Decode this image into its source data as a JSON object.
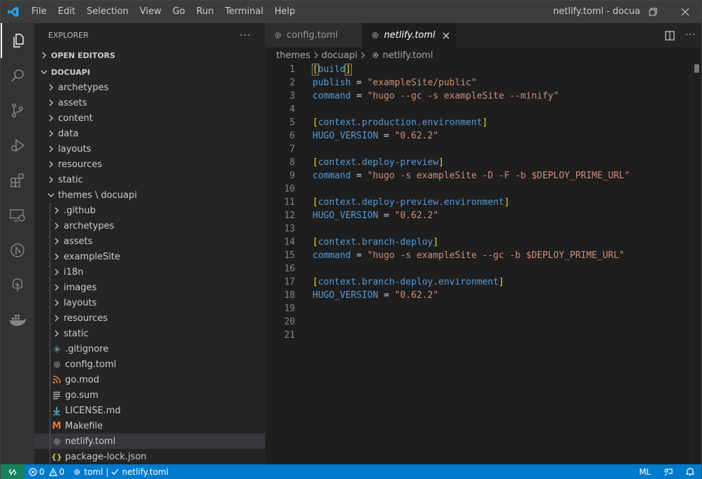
{
  "menu": [
    "File",
    "Edit",
    "Selection",
    "View",
    "Go",
    "Run",
    "Terminal",
    "Help"
  ],
  "window_title": "netlify.toml - docuapi - Visual Studio Code",
  "activity_icons": [
    "files-icon",
    "search-icon",
    "source-control-icon",
    "run-debug-icon",
    "extensions-icon",
    "remote-explorer-icon",
    "git-graph-icon",
    "tree-icon",
    "docker-icon"
  ],
  "sidebar": {
    "title": "EXPLORER",
    "more": "···",
    "open_editors": "OPEN EDITORS",
    "root": "DOCUAPI",
    "items": [
      {
        "label": "archetypes",
        "type": "folder",
        "depth": 1
      },
      {
        "label": "assets",
        "type": "folder",
        "depth": 1
      },
      {
        "label": "content",
        "type": "folder",
        "depth": 1
      },
      {
        "label": "data",
        "type": "folder",
        "depth": 1
      },
      {
        "label": "layouts",
        "type": "folder",
        "depth": 1
      },
      {
        "label": "resources",
        "type": "folder",
        "depth": 1
      },
      {
        "label": "static",
        "type": "folder",
        "depth": 1
      },
      {
        "label": "themes \\ docuapi",
        "type": "folder-open",
        "depth": 1
      },
      {
        "label": ".github",
        "type": "folder",
        "depth": 2
      },
      {
        "label": "archetypes",
        "type": "folder",
        "depth": 2
      },
      {
        "label": "assets",
        "type": "folder",
        "depth": 2
      },
      {
        "label": "exampleSite",
        "type": "folder",
        "depth": 2
      },
      {
        "label": "i18n",
        "type": "folder",
        "depth": 2
      },
      {
        "label": "images",
        "type": "folder",
        "depth": 2
      },
      {
        "label": "layouts",
        "type": "folder",
        "depth": 2
      },
      {
        "label": "resources",
        "type": "folder",
        "depth": 2
      },
      {
        "label": "static",
        "type": "folder",
        "depth": 2
      },
      {
        "label": ".gitignore",
        "type": "gitignore",
        "depth": 2
      },
      {
        "label": "config.toml",
        "type": "gear",
        "depth": 2
      },
      {
        "label": "go.mod",
        "type": "gomod",
        "depth": 2
      },
      {
        "label": "go.sum",
        "type": "gosum",
        "depth": 2
      },
      {
        "label": "LICENSE.md",
        "type": "license",
        "depth": 2
      },
      {
        "label": "Makefile",
        "type": "makefile",
        "depth": 2
      },
      {
        "label": "netlify.toml",
        "type": "gear",
        "depth": 2,
        "selected": true
      },
      {
        "label": "package-lock.json",
        "type": "json",
        "depth": 2
      }
    ]
  },
  "tabs": [
    {
      "label": "config.toml",
      "active": false
    },
    {
      "label": "netlify.toml",
      "active": true
    }
  ],
  "breadcrumb": [
    "themes",
    "docuapi",
    "netlify.toml"
  ],
  "code_lines": [
    [
      {
        "t": "[",
        "c": "#ffd700"
      },
      {
        "t": "build",
        "c": "#569cd6"
      },
      {
        "t": "]",
        "c": "#ffd700"
      }
    ],
    [
      {
        "t": "publish",
        "c": "#569cd6"
      },
      {
        "t": " = ",
        "c": "#d4d4d4"
      },
      {
        "t": "\"exampleSite/public\"",
        "c": "#ce9178"
      }
    ],
    [
      {
        "t": "command",
        "c": "#569cd6"
      },
      {
        "t": " = ",
        "c": "#d4d4d4"
      },
      {
        "t": "\"hugo --gc -s exampleSite --minify\"",
        "c": "#ce9178"
      }
    ],
    [],
    [
      {
        "t": "[",
        "c": "#ffd700"
      },
      {
        "t": "context.production.environment",
        "c": "#569cd6"
      },
      {
        "t": "]",
        "c": "#ffd700"
      }
    ],
    [
      {
        "t": "HUGO_VERSION",
        "c": "#569cd6"
      },
      {
        "t": " = ",
        "c": "#d4d4d4"
      },
      {
        "t": "\"0.62.2\"",
        "c": "#ce9178"
      }
    ],
    [],
    [
      {
        "t": "[",
        "c": "#ffd700"
      },
      {
        "t": "context.deploy-preview",
        "c": "#569cd6"
      },
      {
        "t": "]",
        "c": "#ffd700"
      }
    ],
    [
      {
        "t": "command",
        "c": "#569cd6"
      },
      {
        "t": " = ",
        "c": "#d4d4d4"
      },
      {
        "t": "\"hugo -s exampleSite -D -F -b $DEPLOY_PRIME_URL\"",
        "c": "#ce9178"
      }
    ],
    [],
    [
      {
        "t": "[",
        "c": "#ffd700"
      },
      {
        "t": "context.deploy-preview.environment",
        "c": "#569cd6"
      },
      {
        "t": "]",
        "c": "#ffd700"
      }
    ],
    [
      {
        "t": "HUGO_VERSION",
        "c": "#569cd6"
      },
      {
        "t": " = ",
        "c": "#d4d4d4"
      },
      {
        "t": "\"0.62.2\"",
        "c": "#ce9178"
      }
    ],
    [],
    [
      {
        "t": "[",
        "c": "#ffd700"
      },
      {
        "t": "context.branch-deploy",
        "c": "#569cd6"
      },
      {
        "t": "]",
        "c": "#ffd700"
      }
    ],
    [
      {
        "t": "command",
        "c": "#569cd6"
      },
      {
        "t": " = ",
        "c": "#d4d4d4"
      },
      {
        "t": "\"hugo -s exampleSite --gc -b $DEPLOY_PRIME_URL\"",
        "c": "#ce9178"
      }
    ],
    [],
    [
      {
        "t": "[",
        "c": "#ffd700"
      },
      {
        "t": "context.branch-deploy.environment",
        "c": "#569cd6"
      },
      {
        "t": "]",
        "c": "#ffd700"
      }
    ],
    [
      {
        "t": "HUGO_VERSION",
        "c": "#569cd6"
      },
      {
        "t": " = ",
        "c": "#d4d4d4"
      },
      {
        "t": "\"0.62.2\"",
        "c": "#ce9178"
      }
    ],
    [],
    [],
    []
  ],
  "status": {
    "errors": "0",
    "warnings": "0",
    "language": "toml",
    "file": "netlify.toml",
    "ml": "ML"
  },
  "colors": {
    "status_bar": "#007acc",
    "remote": "#16825d",
    "keyword": "#569cd6",
    "string": "#ce9178",
    "bracket": "#ffd700"
  }
}
